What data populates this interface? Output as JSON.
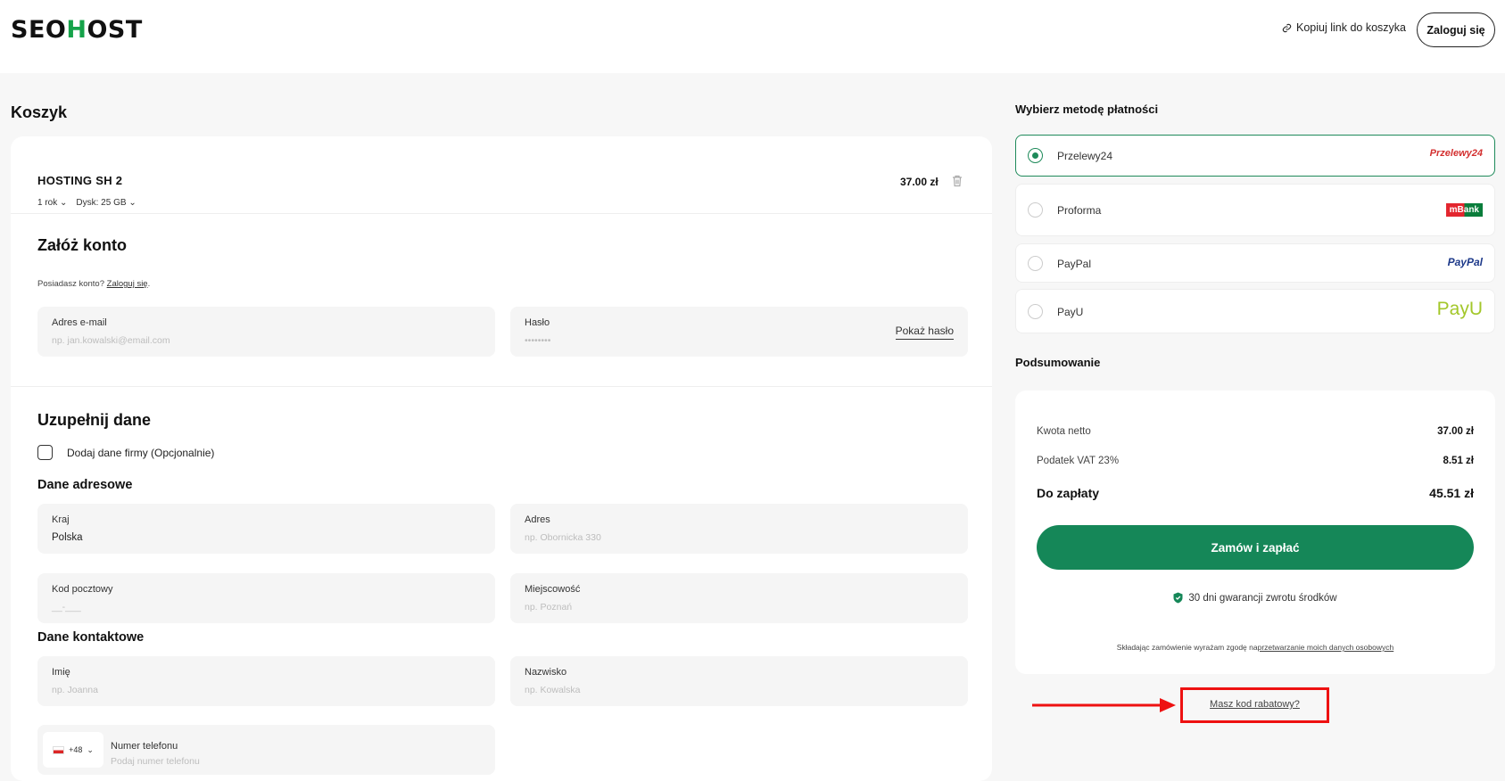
{
  "header": {
    "logo": "SEOHOST",
    "logo_parts": [
      "SEO",
      "H",
      "OST"
    ],
    "copy_link": "Kopiuj link do koszyka",
    "login_button": "Zaloguj się"
  },
  "cart": {
    "title": "Koszyk",
    "product": {
      "name": "HOSTING SH 2",
      "period": "1 rok",
      "disk": "Dysk: 25 GB",
      "price": "37.00 zł"
    }
  },
  "account": {
    "title": "Załóż konto",
    "note_prefix": "Posiadasz konto?",
    "note_link": "Zaloguj się",
    "note_suffix": ".",
    "email_label": "Adres e-mail",
    "email_placeholder": "np. jan.kowalski@email.com",
    "password_label": "Hasło",
    "password_placeholder": "••••••••",
    "show_password": "Pokaż hasło"
  },
  "details": {
    "title": "Uzupełnij dane",
    "company_checkbox": "Dodaj dane firmy (Opcjonalnie)",
    "address_title": "Dane adresowe",
    "country_label": "Kraj",
    "country_value": "Polska",
    "address_label": "Adres",
    "address_placeholder": "np. Obornicka 330",
    "postal_label": "Kod pocztowy",
    "postal_placeholder": "__-___",
    "city_label": "Miejscowość",
    "city_placeholder": "np. Poznań",
    "contact_title": "Dane kontaktowe",
    "firstname_label": "Imię",
    "firstname_placeholder": "np. Joanna",
    "lastname_label": "Nazwisko",
    "lastname_placeholder": "np. Kowalska",
    "phone_prefix": "+48",
    "phone_label": "Numer telefonu",
    "phone_placeholder": "Podaj numer telefonu"
  },
  "payment": {
    "title": "Wybierz metodę płatności",
    "options": [
      {
        "name": "Przelewy24",
        "logo": "Przelewy24",
        "selected": true
      },
      {
        "name": "Proforma",
        "logo": "mBank",
        "selected": false
      },
      {
        "name": "PayPal",
        "logo": "PayPal",
        "selected": false
      },
      {
        "name": "PayU",
        "logo": "PayU",
        "selected": false
      }
    ]
  },
  "summary": {
    "title": "Podsumowanie",
    "net_label": "Kwota netto",
    "net_value": "37.00 zł",
    "vat_label": "Podatek VAT 23%",
    "vat_value": "8.51 zł",
    "total_label": "Do zapłaty",
    "total_value": "45.51 zł",
    "order_button": "Zamów i zapłać",
    "guarantee": "30 dni gwarancji zwrotu środków",
    "consent_prefix": "Składając zamówienie wyrażam zgodę na",
    "consent_link": "przetwarzanie moich danych osobowych",
    "coupon_link": "Masz kod rabatowy?"
  },
  "colors": {
    "accent": "#158758",
    "logo_accent": "#16a34a",
    "annotation": "#ee1111"
  }
}
